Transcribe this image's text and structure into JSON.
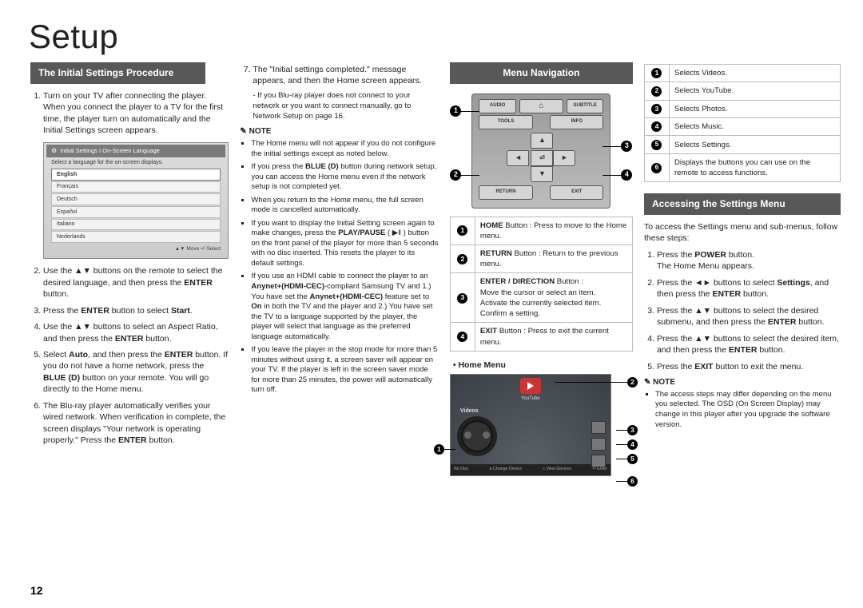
{
  "page_title": "Setup",
  "page_number": "12",
  "col1": {
    "header": "The Initial Settings Procedure",
    "steps": [
      {
        "num": "1.",
        "text": "Turn on your TV after connecting the player.\nWhen you connect the player to a TV for the first time, the player turn on automatically and the Initial Settings screen appears."
      },
      {
        "num": "2.",
        "text_html": "Use the ▲▼ buttons on the remote to select the desired language, and then press the <b>ENTER</b> button."
      },
      {
        "num": "3.",
        "text_html": "Press the <b>ENTER</b> button to select <b>Start</b>."
      },
      {
        "num": "4.",
        "text_html": "Use the ▲▼ buttons to select an Aspect Ratio, and then press the <b>ENTER</b> button."
      },
      {
        "num": "5.",
        "text_html": "Select <b>Auto</b>, and then press the <b>ENTER</b> button. If you do not have a home network, press the <b>BLUE (D)</b> button on your remote. You will go directly to the Home menu."
      },
      {
        "num": "6.",
        "text_html": "The Blu-ray player automatically verifies your wired network. When verification in complete, the screen displays \"Your network is operating properly.\" Press the <b>ENTER</b> button."
      }
    ],
    "osd": {
      "title": "Initial Settings I On-Screen Language",
      "subtitle": "Select a language for the on-screen displays.",
      "items": [
        "English",
        "Français",
        "Deutsch",
        "Español",
        "Italiano",
        "Nederlands"
      ],
      "footer": "▲▼ Move   ⏎ Select"
    }
  },
  "col2": {
    "step7_html": "The \"Initial settings completed.\" message appears, and then the Home screen appears.",
    "step7_sub": "- If you Blu-ray player does not connect to your network or you want to connect manually, go to Network Setup on page 16.",
    "note_label": "NOTE",
    "notes": [
      "The Home menu will not appear if you do not configure the initial settings except as noted below.",
      "If you press the <b>BLUE (D)</b> button during network setup, you can access the Home menu even if the network setup is not completed yet.",
      "When you return to the Home menu, the full screen mode is cancelled automatically.",
      "If you want to display the Initial Setting screen again to make changes, press the <b>PLAY/PAUSE</b> ( ▶‖ ) button on the front panel of the player for more than 5 seconds with no disc inserted. This resets the player to its default settings.",
      "If you use an HDMI cable to connect the player to an <b>Anynet+(HDMI-CEC)</b>-compliant Samsung TV and 1.) You have set the <b>Anynet+(HDMI-CEC)</b> feature set to <b>On</b> in both the TV and the player and 2.) You have set the TV to a language supported by the player, the player will select that language as the preferred language automatically.",
      "If you leave the player in the stop mode for more than 5 minutes without using it, a screen saver will appear on your TV. If the player is left in the screen saver mode for more than 25 minutes, the power will automatically turn off."
    ]
  },
  "col3": {
    "header": "Menu Navigation",
    "remote_buttons": {
      "audio": "AUDIO",
      "home": "HOME",
      "subtitle": "SUBTITLE",
      "tools": "TOOLS",
      "info": "INFO",
      "return": "RETURN",
      "exit": "EXIT",
      "enter": "⏎"
    },
    "callouts": [
      "1",
      "2",
      "3",
      "4"
    ],
    "rows": [
      {
        "n": "1",
        "html": "<b>HOME</b> Button : Press to move to the Home menu."
      },
      {
        "n": "2",
        "html": "<b>RETURN</b> Button : Return to the previous menu."
      },
      {
        "n": "3",
        "html": "<b>ENTER / DIRECTION</b> Button :<br>Move the cursor or select an item.<br>Activate the currently selected item.<br>Confirm a setting."
      },
      {
        "n": "4",
        "html": "<b>EXIT</b> Button : Press to exit the current menu."
      }
    ],
    "home_menu_label": "Home Menu",
    "home_menu": {
      "youtube": "YouTube",
      "videos": "Videos",
      "bottom": [
        "No Disc",
        "a Change Device",
        "c View Devices",
        "⏎ Enter"
      ]
    },
    "hm_callouts": [
      "1",
      "2",
      "3",
      "4",
      "5",
      "6"
    ]
  },
  "col4": {
    "table": [
      {
        "n": "1",
        "text": "Selects Videos."
      },
      {
        "n": "2",
        "text": "Selects YouTube."
      },
      {
        "n": "3",
        "text": "Selects Photos."
      },
      {
        "n": "4",
        "text": "Selects Music."
      },
      {
        "n": "5",
        "text": "Selects Settings."
      },
      {
        "n": "6",
        "text": "Displays the buttons you can use on the remote to access functions."
      }
    ],
    "header": "Accessing the Settings Menu",
    "intro": "To access the Settings menu and sub-menus, follow these steps:",
    "steps": [
      "Press the <b>POWER</b> button.<br>The Home Menu appears.",
      "Press the ◄► buttons to select <b>Settings</b>, and then press the <b>ENTER</b> button.",
      "Press the ▲▼ buttons to select the desired submenu, and then press the <b>ENTER</b> button.",
      "Press the ▲▼ buttons to select the desired item, and then press the <b>ENTER</b> button.",
      "Press the <b>EXIT</b> button to exit the menu."
    ],
    "note_label": "NOTE",
    "note": "The access steps may differ depending on the menu you selected. The OSD (On Screen Display) may change in this player after you upgrade the software version."
  }
}
